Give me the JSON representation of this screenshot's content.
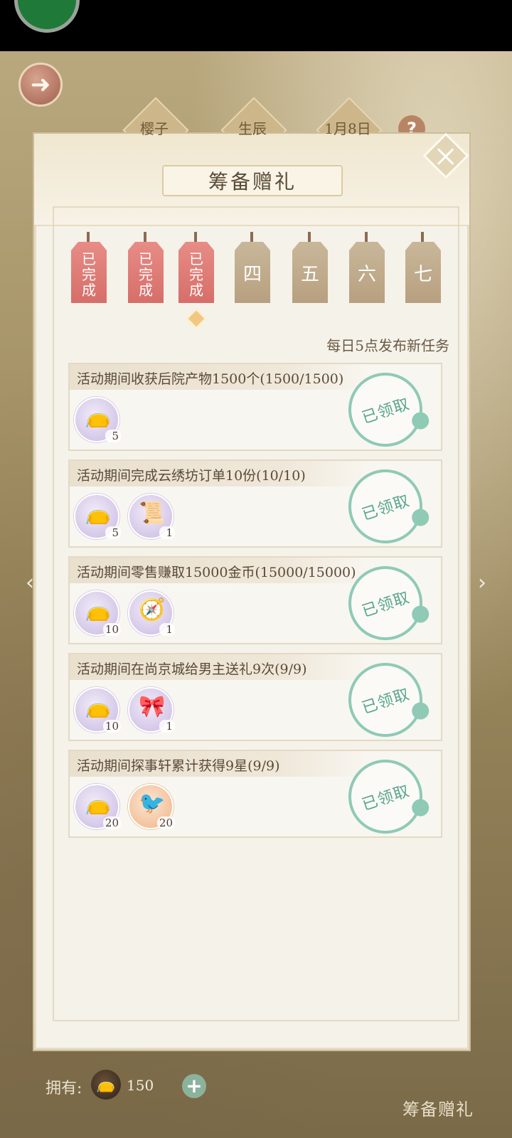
{
  "header": {
    "title": "筹备赠礼",
    "top_tabs": [
      "樱子",
      "生辰",
      "1月8日"
    ]
  },
  "days": [
    {
      "label": "已完成",
      "state": "done"
    },
    {
      "label": "已完成",
      "state": "done"
    },
    {
      "label": "已完成",
      "state": "current"
    },
    {
      "label": "四",
      "state": "todo"
    },
    {
      "label": "五",
      "state": "todo"
    },
    {
      "label": "六",
      "state": "todo"
    },
    {
      "label": "七",
      "state": "todo"
    }
  ],
  "note": "每日5点发布新任务",
  "tasks": [
    {
      "title": "活动期间收获后院产物1500个(1500/1500)",
      "status": "已领取",
      "rewards": [
        {
          "icon": "pouch-icon",
          "qty": "5"
        }
      ]
    },
    {
      "title": "活动期间完成云绣坊订单10份(10/10)",
      "status": "已领取",
      "rewards": [
        {
          "icon": "pouch-icon",
          "qty": "5"
        },
        {
          "icon": "scroll-icon",
          "qty": "1"
        }
      ]
    },
    {
      "title": "活动期间零售赚取15000金币(15000/15000)",
      "status": "已领取",
      "rewards": [
        {
          "icon": "pouch-icon",
          "qty": "10"
        },
        {
          "icon": "compass-icon",
          "qty": "1"
        }
      ]
    },
    {
      "title": "活动期间在尚京城给男主送礼9次(9/9)",
      "status": "已领取",
      "rewards": [
        {
          "icon": "pouch-icon",
          "qty": "10"
        },
        {
          "icon": "knot-charm-icon",
          "qty": "1"
        }
      ]
    },
    {
      "title": "活动期间探事轩累计获得9星(9/9)",
      "status": "已领取",
      "rewards": [
        {
          "icon": "pouch-icon",
          "qty": "20"
        },
        {
          "icon": "jade-bird-icon",
          "qty": "20"
        }
      ]
    }
  ],
  "footer": {
    "owned_label": "拥有:",
    "owned_count": "150",
    "section_label": "筹备赠礼"
  }
}
